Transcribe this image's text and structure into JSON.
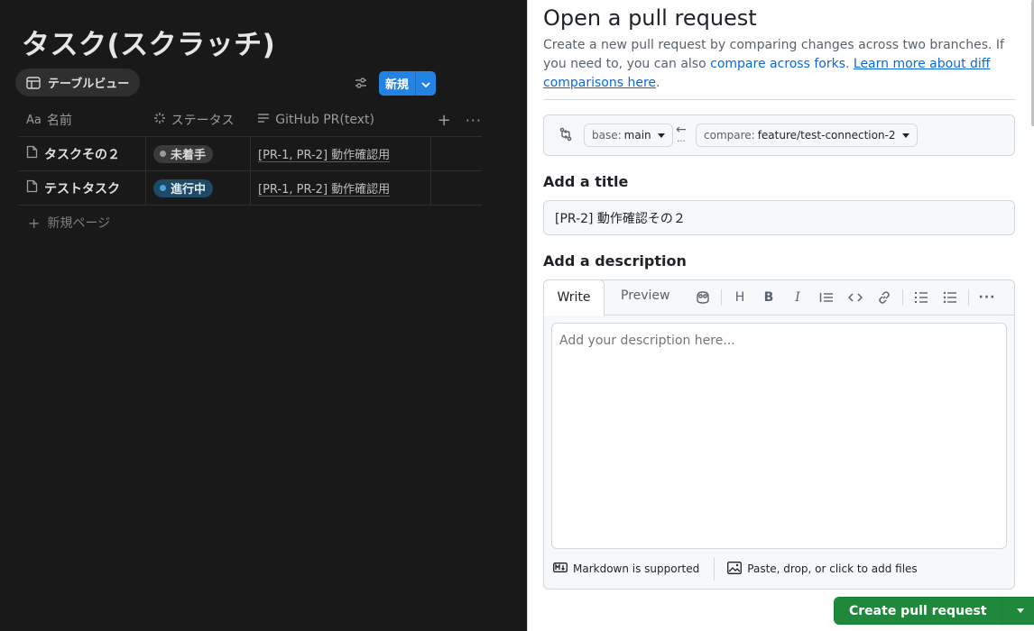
{
  "notion": {
    "title": "タスク(スクラッチ)",
    "view_tab": "テーブルビュー",
    "new_button": "新規",
    "columns": [
      "名前",
      "ステータス",
      "GitHub PR(text)"
    ],
    "rows": [
      {
        "name": "タスクその２",
        "status": "未着手",
        "status_color": "#3a3a3a",
        "pr": "[PR-1, PR-2] 動作確認用"
      },
      {
        "name": "テストタスク",
        "status": "進行中",
        "status_color": "#1f4a66",
        "pr": "[PR-1, PR-2] 動作確認用"
      }
    ],
    "add_page": "新規ページ",
    "icons": [
      "table-icon",
      "filter-icon",
      "chevron-down-icon",
      "text-icon",
      "status-icon",
      "lines-icon",
      "plus-icon",
      "more-icon",
      "page-icon"
    ]
  },
  "github": {
    "heading": "Open a pull request",
    "description": {
      "text1": "Create a new pull request by comparing changes across two branches. If you need to, you can also ",
      "link1": "compare across forks",
      "text2": ". ",
      "link2": "Learn more about diff comparisons here",
      "text3": "."
    },
    "base_label": "base:",
    "base_value": "main",
    "compare_label": "compare:",
    "compare_value": "feature/test-connection-2",
    "add_title_label": "Add a title",
    "title_value": "[PR-2] 動作確認その２",
    "add_description_label": "Add a description",
    "tabs": {
      "write": "Write",
      "preview": "Preview"
    },
    "toolbar": [
      "copilot-icon",
      "heading-icon",
      "bold-icon",
      "italic-icon",
      "quote-icon",
      "code-icon",
      "link-icon",
      "ordered-list-icon",
      "unordered-list-icon",
      "more-icon"
    ],
    "description_placeholder": "Add your description here...",
    "markdown_note": "Markdown is supported",
    "attach_note": "Paste, drop, or click to add files",
    "create_button": "Create pull request",
    "accent_green": "#1f883d",
    "accent_blue": "#0969da"
  }
}
